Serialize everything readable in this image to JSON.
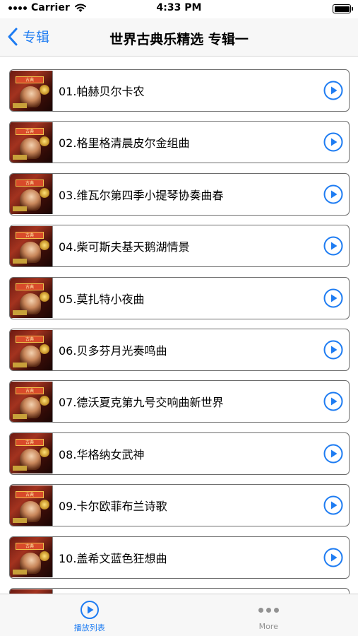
{
  "status_bar": {
    "carrier": "Carrier",
    "time": "4:33 PM"
  },
  "nav": {
    "back_label": "专辑",
    "title": "世界古典乐精选 专辑一"
  },
  "colors": {
    "accent": "#1e7cf2",
    "inactive": "#929292"
  },
  "tracks": [
    {
      "title": "01.帕赫贝尔卡农"
    },
    {
      "title": "02.格里格清晨皮尔金组曲"
    },
    {
      "title": "03.维瓦尔第四季小提琴协奏曲春"
    },
    {
      "title": "04.柴可斯夫基天鹅湖情景"
    },
    {
      "title": "05.莫扎特小夜曲"
    },
    {
      "title": "06.贝多芬月光奏鸣曲"
    },
    {
      "title": "07.德沃夏克第九号交响曲新世界"
    },
    {
      "title": "08.华格纳女武神"
    },
    {
      "title": "09.卡尔欧菲布兰诗歌"
    },
    {
      "title": "10.盖希文蓝色狂想曲"
    },
    {
      "title": ""
    }
  ],
  "tab_bar": {
    "tabs": [
      {
        "label": "播放列表",
        "icon": "play-circle-icon",
        "active": true
      },
      {
        "label": "More",
        "icon": "more-dots-icon",
        "active": false
      }
    ]
  }
}
